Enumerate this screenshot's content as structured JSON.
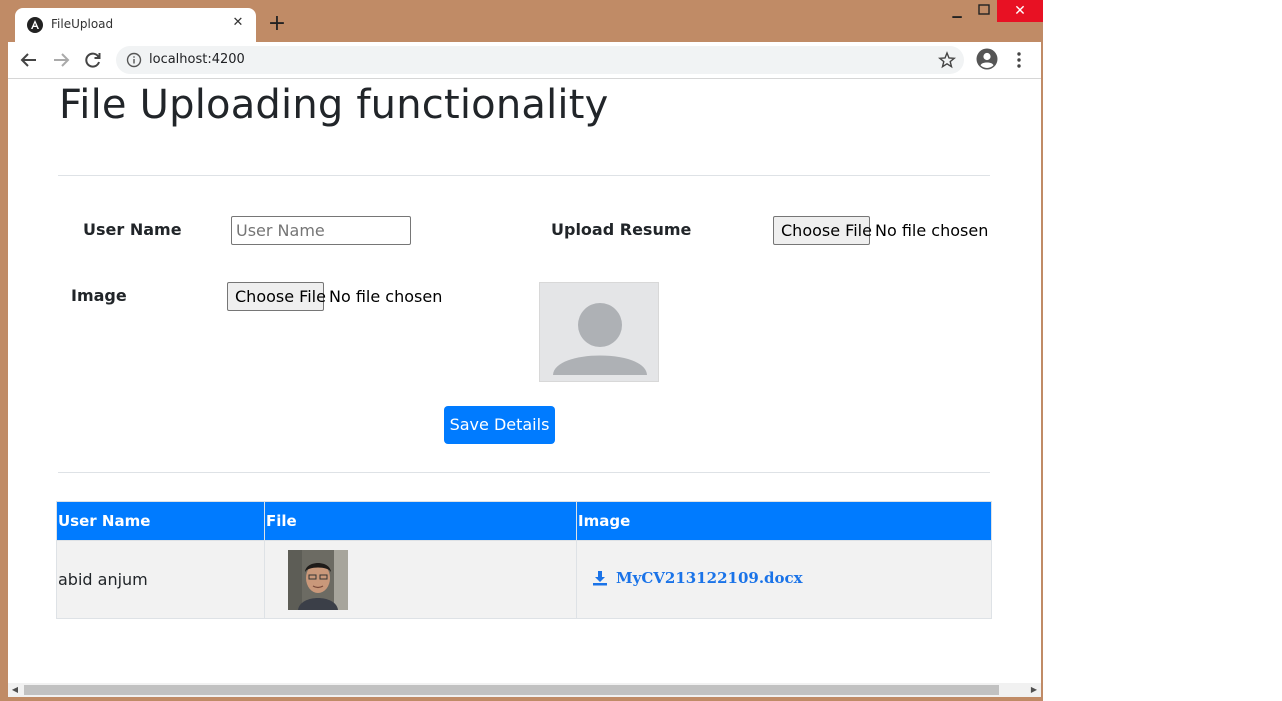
{
  "browser": {
    "tab_title": "FileUpload",
    "url": "localhost:4200"
  },
  "page": {
    "title": "File Uploading functionality"
  },
  "form": {
    "user_name_label": "User Name",
    "user_name_placeholder": "User Name",
    "upload_resume_label": "Upload Resume",
    "resume_button": "Choose File",
    "resume_status": "No file chosen",
    "image_label": "Image",
    "image_button": "Choose File",
    "image_status": "No file chosen",
    "save_button": "Save Details"
  },
  "table": {
    "headers": [
      "User Name",
      "File",
      "Image"
    ],
    "rows": [
      {
        "user_name": "abid anjum",
        "file_link": "MyCV213122109.docx"
      }
    ]
  },
  "colors": {
    "primary": "#007bff",
    "window_frame": "#c08b66",
    "close_button": "#e81123"
  },
  "icons": [
    "angular-favicon-icon",
    "back-arrow-icon",
    "forward-arrow-icon",
    "reload-icon",
    "info-icon",
    "star-icon",
    "profile-icon",
    "menu-dots-icon",
    "user-placeholder-icon",
    "download-icon"
  ]
}
